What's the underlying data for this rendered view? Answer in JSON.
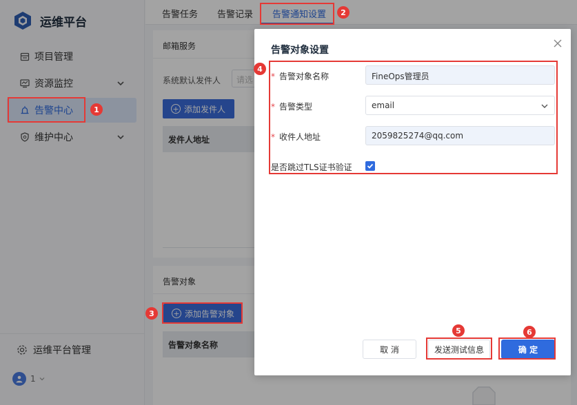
{
  "app": {
    "title": "运维平台",
    "brand_color": "#2f6bde"
  },
  "sidebar": {
    "items": [
      {
        "label": "项目管理",
        "icon": "calendar-icon",
        "active": false,
        "expandable": false
      },
      {
        "label": "资源监控",
        "icon": "monitor-icon",
        "active": false,
        "expandable": true
      },
      {
        "label": "告警中心",
        "icon": "alarm-icon",
        "active": true,
        "expandable": false
      },
      {
        "label": "维护中心",
        "icon": "shield-icon",
        "active": false,
        "expandable": true
      }
    ],
    "management": "运维平台管理",
    "user": "1"
  },
  "tabs": [
    {
      "label": "告警任务",
      "active": false
    },
    {
      "label": "告警记录",
      "active": false
    },
    {
      "label": "告警通知设置",
      "active": true
    }
  ],
  "mail_service": {
    "title": "邮箱服务",
    "default_sender_label": "系统默认发件人",
    "default_sender_placeholder": "请选",
    "add_sender_button": "添加发件人",
    "table_header": "发件人地址"
  },
  "alert_target": {
    "title": "告警对象",
    "add_button": "添加告警对象",
    "table_header": "告警对象名称"
  },
  "modal": {
    "title": "告警对象设置",
    "fields": {
      "name_label": "告警对象名称",
      "name_value": "FineOps管理员",
      "type_label": "告警类型",
      "type_value": "email",
      "address_label": "收件人地址",
      "address_value": "2059825274@qq.com",
      "tls_label": "是否跳过TLS证书验证",
      "tls_checked": true
    },
    "buttons": {
      "cancel": "取 消",
      "test": "发送测试信息",
      "ok": "确 定"
    }
  },
  "annotations": [
    "1",
    "2",
    "3",
    "4",
    "5",
    "6"
  ]
}
